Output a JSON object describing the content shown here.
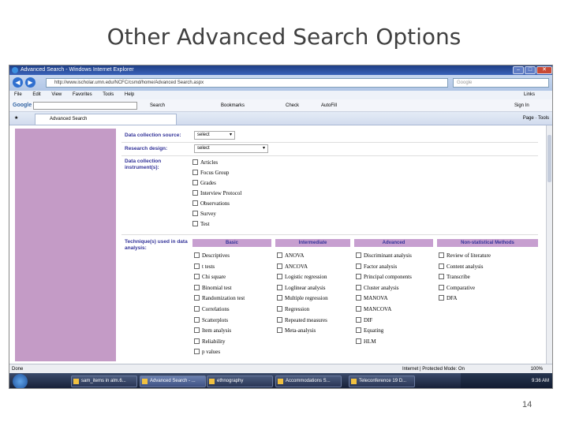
{
  "slide": {
    "title": "Other Advanced Search Options",
    "page_number": "14"
  },
  "window": {
    "title": "Advanced Search - Windows Internet Explorer",
    "url": "http://www.ischolar.umn.edu/NCFC/csmd/home/Advanced Search.aspx",
    "search_placeholder": "Google",
    "menu": [
      "File",
      "Edit",
      "View",
      "Favorites",
      "Tools",
      "Help"
    ],
    "links_label": "Links",
    "google_bar": {
      "logo": "Google",
      "items": [
        "Search",
        "Bookmarks",
        "Check",
        "AutoFill",
        "Sign In"
      ]
    },
    "tab_title": "Advanced Search",
    "tab_tools": [
      "Page",
      "Tools"
    ],
    "status": "Done",
    "zone": "Internet | Protected Mode: On",
    "zoom": "100%"
  },
  "form": {
    "data_collection_source": {
      "label": "Data collection source:",
      "value": "select"
    },
    "research_design": {
      "label": "Research design:",
      "value": "select"
    },
    "instruments": {
      "label": "Data collection instrument(s):",
      "options": [
        "Articles",
        "Focus Group",
        "Grades",
        "Interview Protocol",
        "Observations",
        "Survey",
        "Test"
      ]
    },
    "techniques": {
      "label": "Technique(s) used in data analysis:",
      "columns": [
        {
          "header": "Basic",
          "items": [
            "Descriptives",
            "t tests",
            "Chi square",
            "Binomial test",
            "Randomization test",
            "Correlations",
            "Scatterplots",
            "Item analysis",
            "Reliability",
            "p values"
          ]
        },
        {
          "header": "Intermediate",
          "items": [
            "ANOVA",
            "ANCOVA",
            "Logistic regression",
            "Loglinear analysis",
            "Multiple regression",
            "Regression",
            "Repeated measures",
            "Meta-analysis"
          ]
        },
        {
          "header": "Advanced",
          "items": [
            "Discriminant analysis",
            "Factor analysis",
            "Principal components",
            "Cluster analysis",
            "MANOVA",
            "MANCOVA",
            "DIF",
            "Equating",
            "HLM"
          ]
        },
        {
          "header": "Non-statistical Methods",
          "items": [
            "Review of literature",
            "Content analysis",
            "Transcribe",
            "Comparative",
            "DFA"
          ]
        }
      ]
    }
  },
  "taskbar": {
    "items": [
      "sam_items in alm.6...",
      "Advanced Search - ...",
      "ethnography",
      "Accommodations S...",
      "Teleconference 19 D..."
    ],
    "clock": "9:36 AM"
  }
}
